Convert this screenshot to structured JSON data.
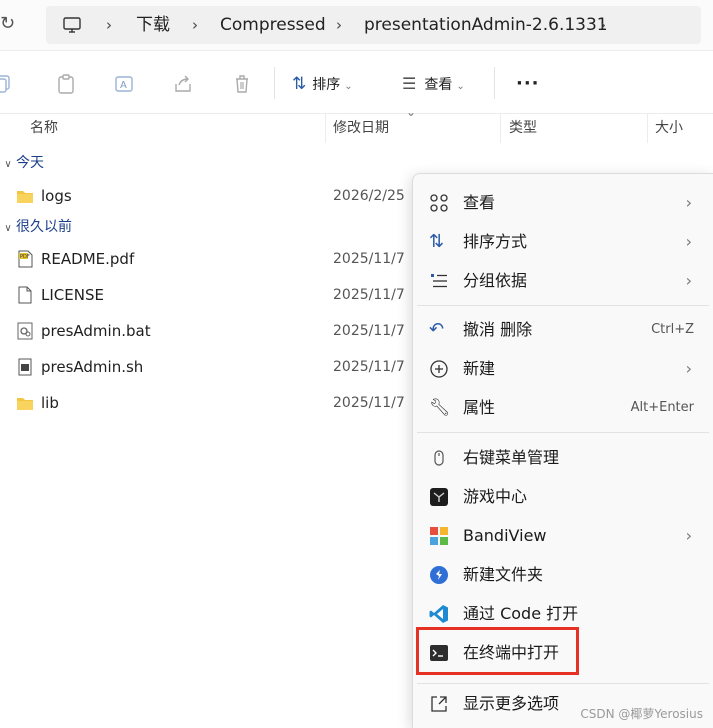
{
  "breadcrumb": {
    "items": [
      "下载",
      "Compressed",
      "presentationAdmin-2.6.1331"
    ]
  },
  "toolbar": {
    "sort_label": "排序",
    "view_label": "查看",
    "more_label": "···"
  },
  "columns": {
    "name": "名称",
    "modified": "修改日期",
    "type": "类型",
    "size": "大小"
  },
  "groups": {
    "today": "今天",
    "long_ago": "很久以前"
  },
  "files": [
    {
      "name": "logs",
      "date": "2026/2/25",
      "icon": "folder-icon"
    },
    {
      "name": "README.pdf",
      "date": "2025/11/7",
      "icon": "pdf-file-icon"
    },
    {
      "name": "LICENSE",
      "date": "2025/11/7",
      "icon": "file-icon"
    },
    {
      "name": "presAdmin.bat",
      "date": "2025/11/7",
      "icon": "bat-file-icon"
    },
    {
      "name": "presAdmin.sh",
      "date": "2025/11/7",
      "icon": "sh-file-icon"
    },
    {
      "name": "lib",
      "date": "2025/11/7",
      "icon": "folder-icon"
    }
  ],
  "menu": {
    "view": "查看",
    "sort_by": "排序方式",
    "group_by": "分组依据",
    "undo_delete": "撤消 删除",
    "undo_shortcut": "Ctrl+Z",
    "new": "新建",
    "properties": "属性",
    "properties_shortcut": "Alt+Enter",
    "context_manager": "右键菜单管理",
    "game_center": "游戏中心",
    "bandiview": "BandiView",
    "new_folder": "新建文件夹",
    "open_code": "通过 Code 打开",
    "open_terminal": "在终端中打开",
    "more_options": "显示更多选项"
  },
  "watermark": "CSDN @椰萝Yerosius",
  "colors": {
    "highlight_border": "#e53224",
    "group_text": "#1d3f8a",
    "folder": "#f4c542"
  }
}
